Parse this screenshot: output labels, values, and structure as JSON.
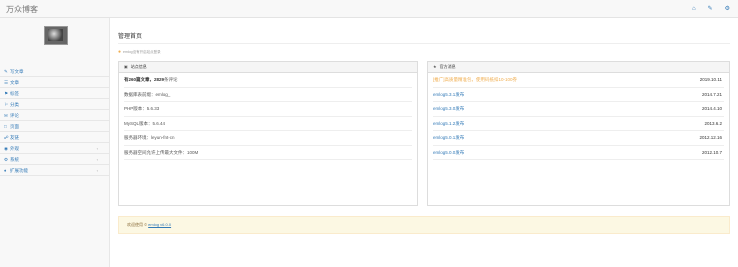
{
  "app": {
    "brand": "万众博客"
  },
  "topbar": {
    "icons": [
      "home-icon",
      "edit-icon",
      "settings-icon"
    ]
  },
  "sidebar": {
    "items": [
      {
        "label": "写文章",
        "icon": "pencil-icon",
        "has_caret": false
      },
      {
        "label": "文章",
        "icon": "list-icon",
        "has_caret": false
      },
      {
        "label": "标签",
        "icon": "tag-icon",
        "has_caret": false
      },
      {
        "label": "分类",
        "icon": "flag-icon",
        "has_caret": false
      },
      {
        "label": "评论",
        "icon": "comment-icon",
        "has_caret": false
      },
      {
        "label": "页面",
        "icon": "file-icon",
        "has_caret": false
      },
      {
        "label": "友链",
        "icon": "link-icon",
        "has_caret": false
      },
      {
        "label": "外观",
        "icon": "eye-icon",
        "has_caret": true
      },
      {
        "label": "系统",
        "icon": "gear-icon",
        "has_caret": true
      },
      {
        "label": "扩展功能",
        "icon": "puzzle-icon",
        "has_caret": true
      }
    ]
  },
  "main": {
    "title": "管理首页",
    "notice": "emlog没有开启站点登录",
    "stats_panel": {
      "title": "站点信息",
      "rows": [
        {
          "prefix": "有",
          "count": "260",
          "mid": "篇文章，",
          "count2": "2829",
          "suffix": "条评论"
        },
        {
          "text": "数据库表前缀：emlog_"
        },
        {
          "text": "PHP版本：5.6.33"
        },
        {
          "text": "MySQL版本：5.6.44"
        },
        {
          "text": "服务器环境：leyun-fnt-cn"
        },
        {
          "text": "服务器空间允许上传最大文件：100M"
        }
      ]
    },
    "news_panel": {
      "title": "官方消息",
      "rows": [
        {
          "text": "[推广]高质量精准包，使用码抵扣10-100券",
          "date": "2019.10.11",
          "warn": true
        },
        {
          "text": "emlog5.3.1发布",
          "date": "2014.7.21",
          "warn": false
        },
        {
          "text": "emlog5.3.0发布",
          "date": "2014.4.10",
          "warn": false
        },
        {
          "text": "emlog5.1.2发布",
          "date": "2013.6.2",
          "warn": false
        },
        {
          "text": "emlog5.0.1发布",
          "date": "2012.12.16",
          "warn": false
        },
        {
          "text": "emlog5.0.0发布",
          "date": "2012.10.7",
          "warn": false
        }
      ]
    },
    "footer": {
      "prefix": "欢迎使用 © ",
      "link": "emlog v6.0.0"
    }
  },
  "colors": {
    "link": "#337ab7",
    "warn": "#f0ad4e",
    "alert_bg": "#fcf8e3"
  }
}
